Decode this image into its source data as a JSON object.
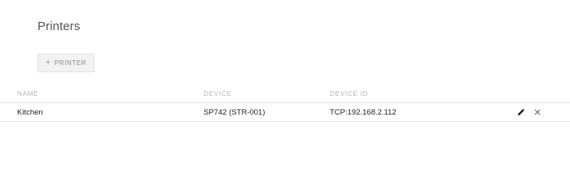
{
  "page": {
    "title": "Printers"
  },
  "toolbar": {
    "add_icon": "plus-icon",
    "add_label": "PRINTER"
  },
  "table": {
    "headers": {
      "name": "NAME",
      "device": "DEVICE",
      "device_id": "DEVICE ID"
    },
    "rows": [
      {
        "name": "Kitchen",
        "device": "SP742 (STR-001)",
        "device_id": "TCP:192.168.2.112",
        "actions": [
          "pencil-icon",
          "close-icon"
        ]
      }
    ]
  }
}
